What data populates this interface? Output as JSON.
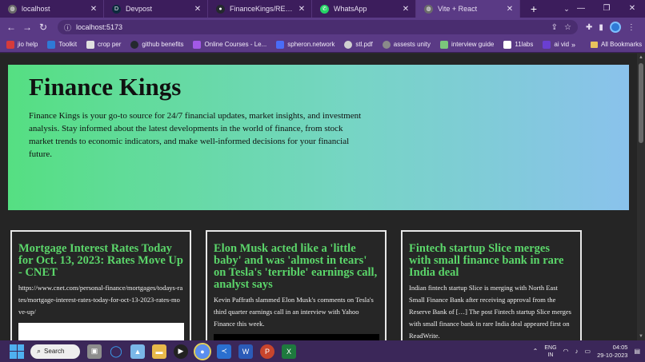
{
  "tabs": [
    {
      "title": "localhost",
      "icon": "globe-icon",
      "color": "#6b6b6b",
      "active": false
    },
    {
      "title": "Devpost",
      "icon": "devpost-icon",
      "color": "#0d2b3e",
      "active": false
    },
    {
      "title": "FinanceKings/README.m",
      "icon": "github-icon",
      "color": "#24292e",
      "active": false
    },
    {
      "title": "WhatsApp",
      "icon": "whatsapp-icon",
      "color": "#25d366",
      "active": false
    },
    {
      "title": "Vite + React",
      "icon": "globe-icon",
      "color": "#6b6b6b",
      "active": true
    }
  ],
  "address": {
    "url": "localhost:5173"
  },
  "bookmarks": [
    {
      "label": "jio help",
      "color": "#d63b3b"
    },
    {
      "label": "Toolkit",
      "color": "#2f7ad6"
    },
    {
      "label": "crop per",
      "color": "#e0e0e0"
    },
    {
      "label": "github benefits",
      "color": "#24292e"
    },
    {
      "label": "Online Courses - Le...",
      "color": "#a259e6"
    },
    {
      "label": "spheron.network",
      "color": "#4a6cf7"
    },
    {
      "label": "stl.pdf",
      "color": "#d0d0d0"
    },
    {
      "label": "assests unity",
      "color": "#8a8a8a"
    },
    {
      "label": "interview guide",
      "color": "#7bc67b"
    },
    {
      "label": "11labs",
      "color": "#ffffff"
    },
    {
      "label": "ai vid",
      "color": "#6a3fd1"
    }
  ],
  "bookmarks_more": "»",
  "bookmarks_all": "All Bookmarks",
  "hero": {
    "title": "Finance Kings",
    "description": "Finance Kings is your go-to source for 24/7 financial updates, market insights, and investment analysis. Stay informed about the latest developments in the world of finance, from stock market trends to economic indicators, and make well-informed decisions for your financial future."
  },
  "articles": [
    {
      "title": "Mortgage Interest Rates Today for Oct. 13, 2023: Rates Move Up - CNET",
      "body": "https://www.cnet.com/personal-finance/mortgages/todays-rates/mortgage-interest-rates-today-for-oct-13-2023-rates-move-up/"
    },
    {
      "title": "Elon Musk acted like a 'little baby' and was 'almost in tears' on Tesla's 'terrible' earnings call, analyst says",
      "body": "Kevin Paffrath slammed Elon Musk's comments on Tesla's third quarter earnings call in an interview with Yahoo Finance this week."
    },
    {
      "title": "Fintech startup Slice merges with small finance bank in rare India deal",
      "body": "Indian fintech startup Slice is merging with North East Small Finance Bank after receiving approval from the Reserve Bank of […] The post Fintech startup Slice merges with small finance bank in rare India deal appeared first on ReadWrite."
    }
  ],
  "taskbar": {
    "search_label": "Search",
    "lang_line1": "ENG",
    "lang_line2": "IN",
    "time": "04:05",
    "date": "29-10-2023"
  }
}
